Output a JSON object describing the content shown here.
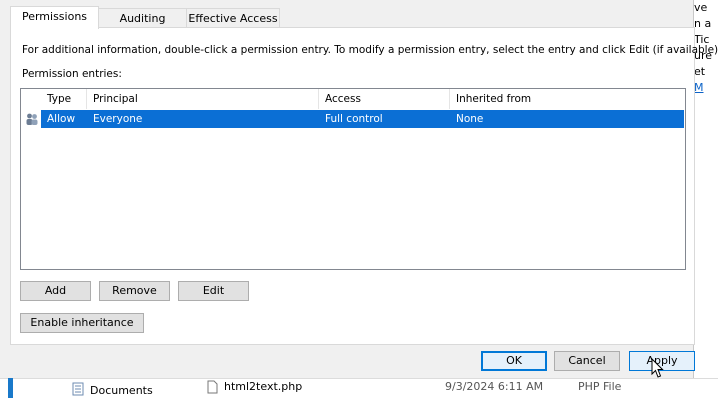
{
  "tabs": [
    {
      "label": "Permissions",
      "active": true
    },
    {
      "label": "Auditing",
      "active": false
    },
    {
      "label": "Effective Access",
      "active": false
    }
  ],
  "info_text": "For additional information, double-click a permission entry. To modify a permission entry, select the entry and click Edit (if available).",
  "entries_label": "Permission entries:",
  "columns": [
    "Type",
    "Principal",
    "Access",
    "Inherited from"
  ],
  "entries": [
    {
      "type": "Allow",
      "principal": "Everyone",
      "access": "Full control",
      "inherited_from": "None",
      "icon": "users-icon",
      "selected": true
    }
  ],
  "buttons": {
    "add": "Add",
    "remove": "Remove",
    "edit": "Edit",
    "enable_inheritance": "Enable inheritance",
    "ok": "OK",
    "cancel": "Cancel",
    "apply": "Apply"
  },
  "background_window": {
    "right_fragments": [
      "ve",
      "n a",
      "Tic",
      "ure",
      "et",
      "M"
    ],
    "explorer_row": {
      "folder": "Documents",
      "file_name": "html2text.php",
      "date": "9/3/2024 6:11 AM",
      "file_type": "PHP File"
    }
  },
  "colors": {
    "selection": "#0b6fd5",
    "dialog_bg": "#f0f0f0",
    "accent": "#0078d7"
  }
}
